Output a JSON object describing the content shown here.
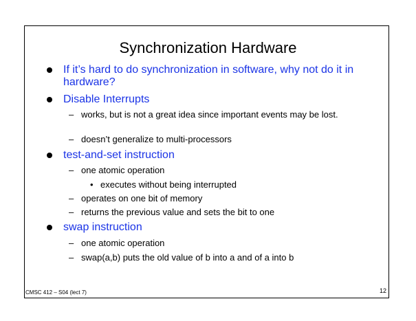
{
  "slide": {
    "title": "Synchronization Hardware",
    "bullets": [
      {
        "text": "If it’s hard to do synchronization in software, why not do it in hardware?",
        "subs": []
      },
      {
        "text": "Disable Interrupts",
        "subs": [
          {
            "text": "works, but is not a great idea since important events may be lost.",
            "subs": []
          },
          {
            "text": "doesn’t generalize to multi-processors",
            "subs": []
          }
        ]
      },
      {
        "text": "test-and-set instruction",
        "subs": [
          {
            "text": "one atomic operation",
            "subs": [
              "executes without being interrupted"
            ]
          },
          {
            "text": "operates on one bit of memory",
            "subs": []
          },
          {
            "text": "returns the previous value and sets the bit to one",
            "subs": []
          }
        ]
      },
      {
        "text": "swap instruction",
        "subs": [
          {
            "text": "one atomic operation",
            "subs": []
          },
          {
            "text": "swap(a,b) puts the old value of b into a and of a into b",
            "subs": []
          }
        ]
      }
    ],
    "footer_left": "CMSC 412 – S04  (lect 7)",
    "page_number": "12"
  },
  "colors": {
    "bullet_text": "#1a33e6",
    "body_text": "#000000",
    "background": "#ffffff"
  },
  "icons": {
    "level1_marker": "filled-circle",
    "level2_marker": "en-dash",
    "level3_marker": "small-bullet"
  }
}
